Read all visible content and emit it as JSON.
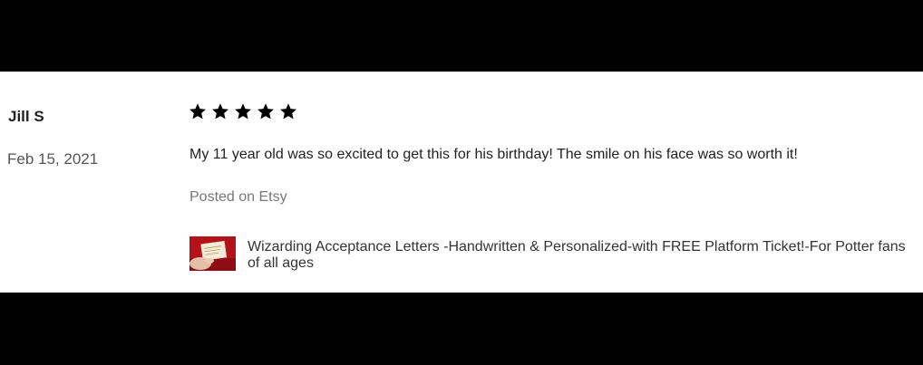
{
  "review": {
    "reviewer_name": "Jill S",
    "date": "Feb 15, 2021",
    "rating": 5,
    "text": "My 11 year old was so excited to get this for his birthday! The smile on his face was so worth it!",
    "source": "Posted on Etsy",
    "product_title": "Wizarding Acceptance Letters -Handwritten & Personalized-with FREE Platform Ticket!-For Potter fans of all ages"
  },
  "colors": {
    "background": "#000000",
    "card": "#ffffff",
    "star": "#000000",
    "thumbnail": "#b3121b"
  },
  "icons": [
    "star-icon"
  ]
}
